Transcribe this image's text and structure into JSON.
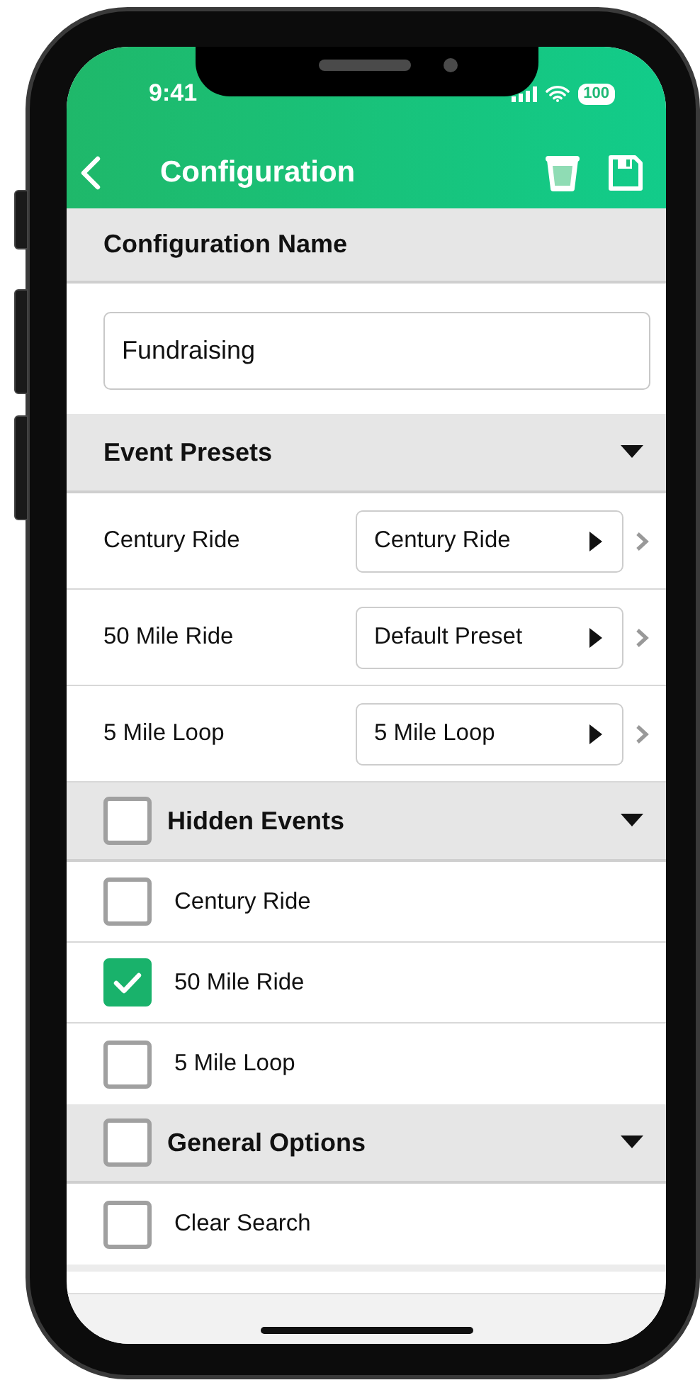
{
  "status_bar": {
    "time": "9:41",
    "battery": "100"
  },
  "header": {
    "title": "Configuration"
  },
  "sections": [
    {
      "kind": "name",
      "title": "Configuration Name",
      "value": "Fundraising"
    },
    {
      "kind": "presets",
      "title": "Event Presets",
      "expanded": true,
      "rows": [
        {
          "label": "Century Ride",
          "preset": "Century Ride"
        },
        {
          "label": "50 Mile Ride",
          "preset": "Default Preset"
        },
        {
          "label": "5 Mile Loop",
          "preset": "5 Mile Loop"
        }
      ]
    },
    {
      "kind": "checklist",
      "title": "Hidden Events",
      "checked": false,
      "expanded": true,
      "items": [
        {
          "label": "Century Ride",
          "checked": false
        },
        {
          "label": "50 Mile Ride",
          "checked": true
        },
        {
          "label": "5 Mile Loop",
          "checked": false
        }
      ]
    },
    {
      "kind": "checklist",
      "title": "General Options",
      "checked": false,
      "expanded": true,
      "items": [
        {
          "label": "Clear Search",
          "checked": false
        }
      ]
    }
  ]
}
